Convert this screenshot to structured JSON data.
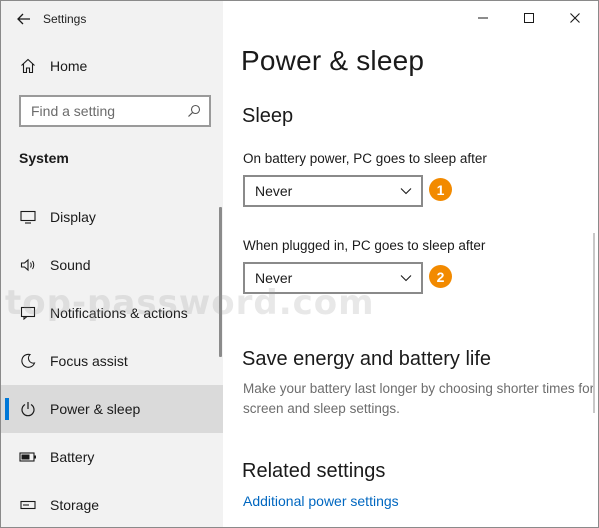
{
  "window": {
    "app_title": "Settings",
    "controls": [
      "minimize-icon",
      "maximize-icon",
      "close-icon"
    ]
  },
  "sidebar": {
    "home_label": "Home",
    "search_placeholder": "Find a setting",
    "section_label": "System",
    "items": [
      {
        "label": "Display",
        "icon": "monitor-icon"
      },
      {
        "label": "Sound",
        "icon": "speaker-icon"
      },
      {
        "label": "Notifications & actions",
        "icon": "notification-icon"
      },
      {
        "label": "Focus assist",
        "icon": "moon-icon"
      },
      {
        "label": "Power & sleep",
        "icon": "power-icon",
        "selected": true
      },
      {
        "label": "Battery",
        "icon": "battery-icon"
      },
      {
        "label": "Storage",
        "icon": "storage-icon"
      }
    ]
  },
  "main": {
    "page_title": "Power & sleep",
    "sleep_heading": "Sleep",
    "battery_label": "On battery power, PC goes to sleep after",
    "battery_value": "Never",
    "plugged_label": "When plugged in, PC goes to sleep after",
    "plugged_value": "Never",
    "save_heading": "Save energy and battery life",
    "save_description": "Make your battery last longer by choosing shorter times for screen and sleep settings.",
    "related_heading": "Related settings",
    "related_link": "Additional power settings"
  },
  "annotations": {
    "badge1": "1",
    "badge2": "2",
    "badge_color": "#f28a00"
  },
  "watermark": "top-password.com",
  "colors": {
    "accent": "#0078d7",
    "link": "#0067c0",
    "sidebar_bg": "#f2f2f2",
    "selected_bg": "#dadada"
  }
}
